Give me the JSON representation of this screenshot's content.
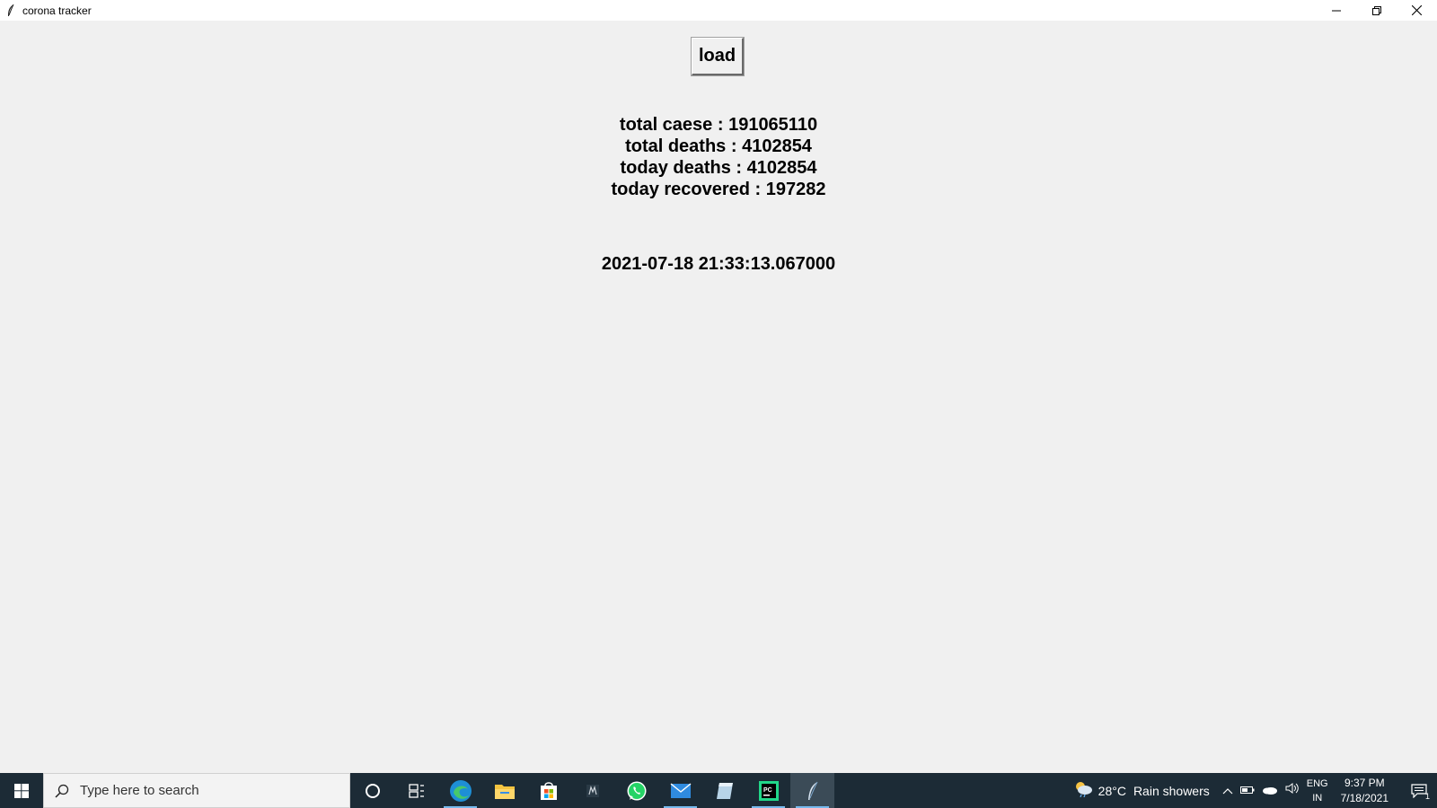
{
  "window": {
    "title": "corona tracker",
    "app_icon": "feather-icon",
    "controls": [
      "minimize-icon",
      "restore-icon",
      "close-icon"
    ]
  },
  "main": {
    "load_button_label": "load",
    "stats": {
      "total_cases": "total caese : 191065110",
      "total_deaths": "total deaths : 4102854",
      "today_deaths": "today deaths : 4102854",
      "today_recovered": "today recovered : 197282"
    },
    "timestamp": "2021-07-18 21:33:13.067000"
  },
  "taskbar": {
    "search_placeholder": "Type here to search",
    "pinned_icons": [
      "cortana-icon",
      "task-view-icon",
      "edge-icon",
      "file-explorer-icon",
      "store-icon",
      "app-icon",
      "whatsapp-icon",
      "mail-icon",
      "notes-icon",
      "pycharm-icon",
      "python-feather-icon"
    ],
    "weather": {
      "temperature": "28°C",
      "condition": "Rain showers"
    },
    "language": {
      "line1": "ENG",
      "line2": "IN"
    },
    "clock": {
      "time": "9:37 PM",
      "date": "7/18/2021"
    },
    "notification_count": "1"
  },
  "colors": {
    "background": "#f0f0f0",
    "taskbar": "#1c2b36",
    "accent": "#76b9ed"
  }
}
